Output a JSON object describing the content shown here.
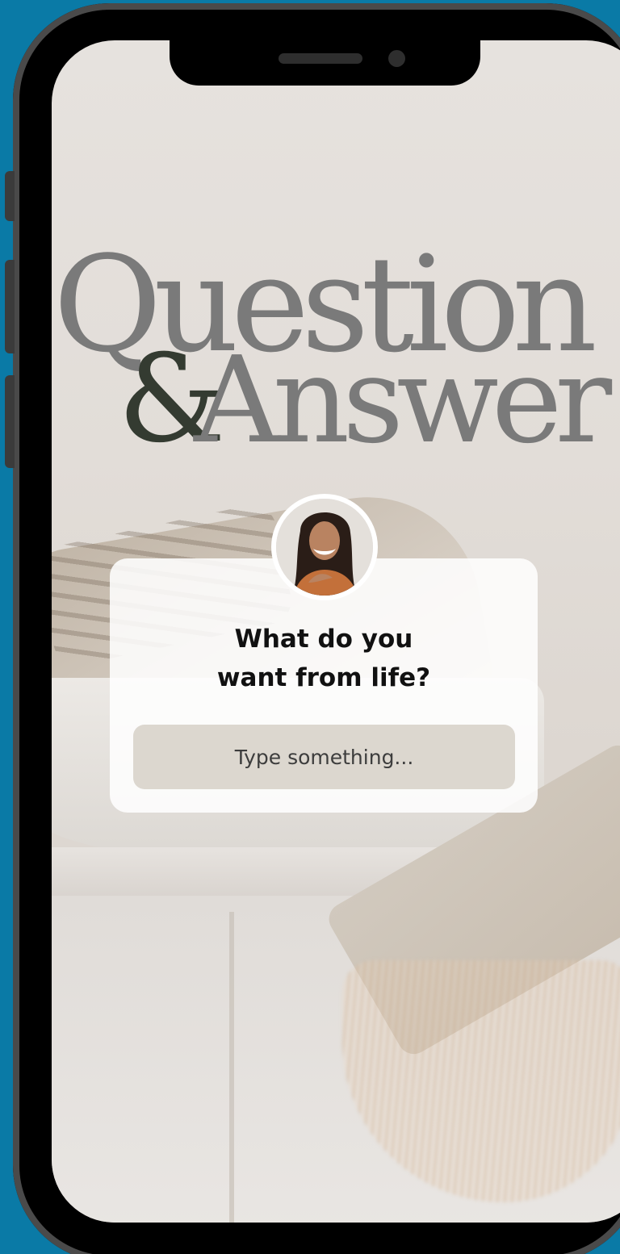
{
  "story": {
    "title_line1": "Question",
    "title_ampersand": "&",
    "title_line2": "Answer",
    "question_line1": "What do you",
    "question_line2": "want from life?",
    "answer_placeholder": "Type something..."
  },
  "colors": {
    "background": "#0a7aa6",
    "title_gray": "#7a7a7a",
    "ampersand_green": "#343b31",
    "input_bg": "#dcd7cf"
  },
  "icons": {
    "avatar": "profile-photo-woman-smiling"
  }
}
